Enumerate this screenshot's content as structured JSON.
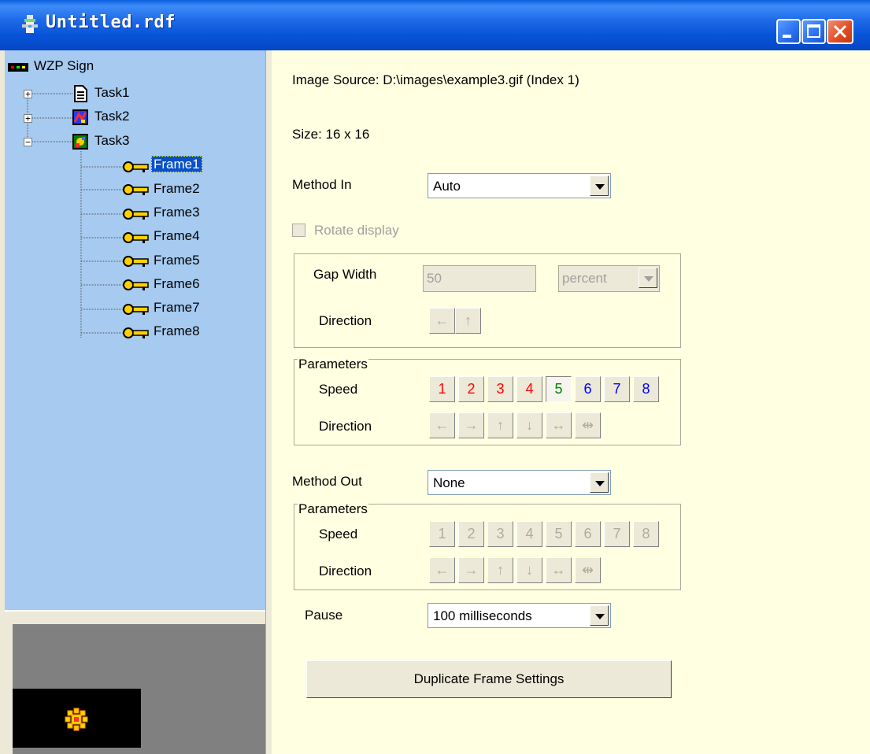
{
  "window": {
    "title": "Untitled.rdf"
  },
  "tree": {
    "root": "WZP Sign",
    "tasks": [
      {
        "label": "Task1",
        "expander": "+"
      },
      {
        "label": "Task2",
        "expander": "+"
      },
      {
        "label": "Task3",
        "expander": "−"
      }
    ],
    "frames": [
      "Frame1",
      "Frame2",
      "Frame3",
      "Frame4",
      "Frame5",
      "Frame6",
      "Frame7",
      "Frame8"
    ],
    "selected": "Frame1"
  },
  "props": {
    "image_source": "Image Source: D:\\images\\example3.gif (Index 1)",
    "size": "Size: 16 x 16",
    "method_in": {
      "label": "Method In",
      "value": "Auto"
    },
    "rotate": {
      "label": "Rotate display",
      "checked": false,
      "enabled": false
    },
    "gap": {
      "width_label": "Gap Width",
      "width_value": "50",
      "unit_value": "percent",
      "direction_label": "Direction",
      "directions": [
        "←",
        "↑"
      ]
    },
    "params_in": {
      "caption": "Parameters",
      "speed_label": "Speed",
      "speeds": [
        "1",
        "2",
        "3",
        "4",
        "5",
        "6",
        "7",
        "8"
      ],
      "selected_speed": "5",
      "direction_label": "Direction",
      "directions": [
        "←",
        "→",
        "↑",
        "↓",
        "↔",
        "⇹"
      ]
    },
    "method_out": {
      "label": "Method Out",
      "value": "None"
    },
    "params_out": {
      "caption": "Parameters",
      "speed_label": "Speed",
      "speeds": [
        "1",
        "2",
        "3",
        "4",
        "5",
        "6",
        "7",
        "8"
      ],
      "direction_label": "Direction",
      "directions": [
        "←",
        "→",
        "↑",
        "↓",
        "↔",
        "⇹"
      ]
    },
    "pause": {
      "label": "Pause",
      "value": "100 milliseconds"
    },
    "duplicate_button": "Duplicate Frame Settings"
  },
  "icons": {
    "app": "hydrant-icon",
    "root": "led-sign-icon",
    "task1": "document-icon",
    "task2": "image-task-icon",
    "task3": "image-task-icon",
    "frame": "key-frame-icon",
    "preview": "sun-icon"
  },
  "colors": {
    "title_bar": "#0754d8",
    "tree_bg": "#a6caf0",
    "panel_bg": "#ffffe1",
    "selection": "#0a50c8"
  }
}
